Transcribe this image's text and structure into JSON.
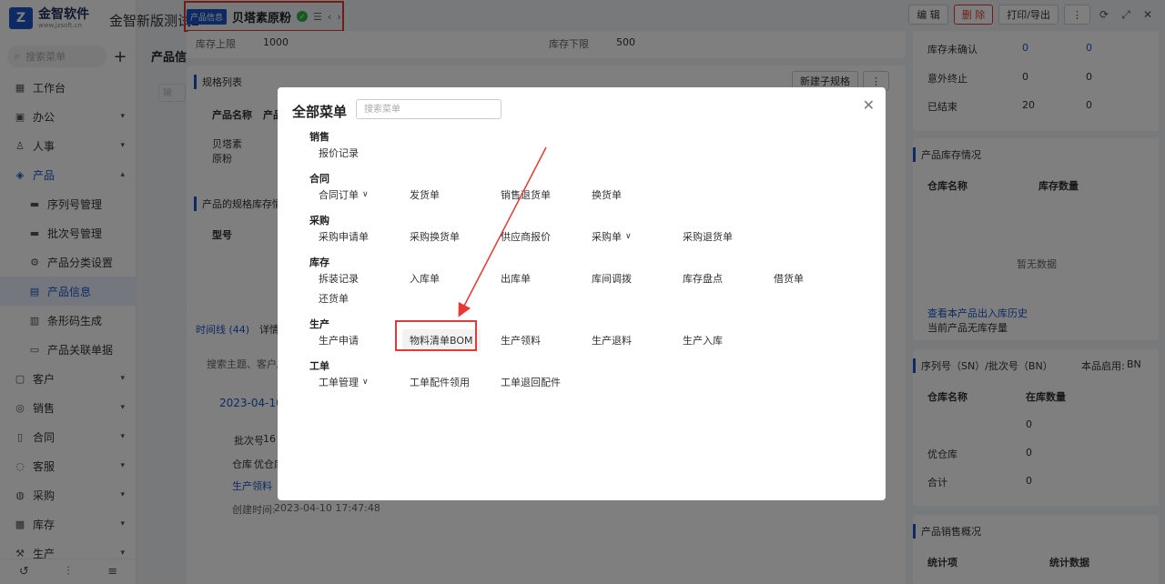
{
  "sidebar": {
    "logo_text": "金智软件",
    "logo_sub": "www.jzsoft.cn",
    "search_placeholder": "搜索菜单",
    "items": [
      {
        "label": "工作台",
        "icon": "dashboard-icon"
      },
      {
        "label": "办公",
        "icon": "office-icon"
      },
      {
        "label": "人事",
        "icon": "person-icon"
      },
      {
        "label": "产品",
        "icon": "cube-icon"
      },
      {
        "label": "序列号管理",
        "icon": "folder-icon"
      },
      {
        "label": "批次号管理",
        "icon": "folder-icon"
      },
      {
        "label": "产品分类设置",
        "icon": "gear-icon"
      },
      {
        "label": "产品信息",
        "icon": "list-icon"
      },
      {
        "label": "条形码生成",
        "icon": "barcode-icon"
      },
      {
        "label": "产品关联单据",
        "icon": "doc-icon"
      },
      {
        "label": "客户",
        "icon": "customer-icon"
      },
      {
        "label": "销售",
        "icon": "sales-icon"
      },
      {
        "label": "合同",
        "icon": "contract-icon"
      },
      {
        "label": "客服",
        "icon": "service-icon"
      },
      {
        "label": "采购",
        "icon": "purchase-icon"
      },
      {
        "label": "库存",
        "icon": "stock-icon"
      },
      {
        "label": "生产",
        "icon": "production-icon"
      }
    ]
  },
  "header": {
    "app_title": "金智新版测试2",
    "tab_tag": "产品信息",
    "tab_title": "贝塔素原粉",
    "actions": {
      "edit": "编 辑",
      "delete": "删 除",
      "print": "打印/导出"
    }
  },
  "background": {
    "side_title": "产品信",
    "stock_upper_label": "库存上限",
    "stock_upper": "1000",
    "stock_lower_label": "库存下限",
    "stock_lower": "500",
    "spec_title": "规格列表",
    "new_spec": "新建子规格",
    "col_product_name": "产品名称",
    "col_product_short": "产品",
    "product_name": "贝塔素原粉",
    "spec_stock_title": "产品的规格库存情况",
    "model_label": "型号",
    "timeline_tab": "时间线 (44)",
    "detail_tab": "详情",
    "search_topic_placeholder": "搜索主题、客户/...",
    "date": "2023-04-10",
    "batch_label": "批次号",
    "batch_no": "16",
    "warehouse_label": "仓库",
    "warehouse_value": "优仓库",
    "type_tag": "生产领料",
    "created_label": "创建时间:",
    "created_value": "2023-04-10 17:47:48",
    "right_rows": [
      {
        "label": "库存未确认",
        "a": "0",
        "b": "0"
      },
      {
        "label": "意外终止",
        "a": "0",
        "b": "0"
      },
      {
        "label": "已结束",
        "a": "20",
        "b": "0"
      }
    ],
    "stock_status_title": "产品库存情况",
    "col_warehouse": "仓库名称",
    "col_qty": "库存数量",
    "empty": "暂无数据",
    "history_link": "查看本产品出入库历史",
    "no_stock": "当前产品无库存量",
    "sn_title": "序列号（SN）/批次号（BN）",
    "enabled_label": "本品启用:",
    "enabled_value": "BN",
    "col_instock": "在库数量",
    "sn_rows": [
      {
        "name": "",
        "qty": "0"
      },
      {
        "name": "优仓库",
        "qty": "0"
      },
      {
        "name": "合计",
        "qty": "0"
      }
    ],
    "sales_title": "产品销售概况",
    "col_stat_item": "统计项",
    "col_stat_data": "统计数据"
  },
  "modal": {
    "title": "全部菜单",
    "search_placeholder": "搜索菜单",
    "sections": [
      {
        "title": "销售",
        "items": [
          "报价记录"
        ]
      },
      {
        "title": "合同",
        "items": [
          "合同订单",
          "发货单",
          "销售退货单",
          "换货单"
        ]
      },
      {
        "title": "采购",
        "items": [
          "采购申请单",
          "采购换货单",
          "供应商报价",
          "采购单",
          "采购退货单"
        ]
      },
      {
        "title": "库存",
        "items": [
          "拆装记录",
          "入库单",
          "出库单",
          "库间调拨",
          "库存盘点",
          "借货单",
          "还货单"
        ]
      },
      {
        "title": "生产",
        "items": [
          "生产申请",
          "物料清单BOM",
          "生产领料",
          "生产退料",
          "生产入库"
        ]
      },
      {
        "title": "工单",
        "items": [
          "工单管理",
          "工单配件领用",
          "工单退回配件"
        ]
      }
    ]
  }
}
